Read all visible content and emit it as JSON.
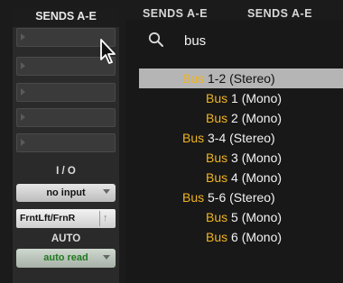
{
  "sends_strip": {
    "header": "SENDS A-E",
    "io_label": "I / O",
    "input_value": "no input",
    "output_value": "FrntLft/FrnR",
    "output_pin": "↑",
    "auto_label": "AUTO",
    "auto_value": "auto read"
  },
  "background_columns": [
    {
      "header": "SENDS A-E"
    },
    {
      "header": "SENDS A-E"
    }
  ],
  "search": {
    "query": "bus",
    "highlight_color": "#f0b323"
  },
  "results": [
    {
      "match": "Bus",
      "rest": " 1-2 (Stereo)"
    },
    {
      "match": "Bus",
      "rest": " 1 (Mono)"
    },
    {
      "match": "Bus",
      "rest": " 2 (Mono)"
    },
    {
      "match": "Bus",
      "rest": " 3-4 (Stereo)"
    },
    {
      "match": "Bus",
      "rest": " 3 (Mono)"
    },
    {
      "match": "Bus",
      "rest": " 4 (Mono)"
    },
    {
      "match": "Bus",
      "rest": " 5-6 (Stereo)"
    },
    {
      "match": "Bus",
      "rest": " 5 (Mono)"
    },
    {
      "match": "Bus",
      "rest": " 6 (Mono)"
    }
  ]
}
